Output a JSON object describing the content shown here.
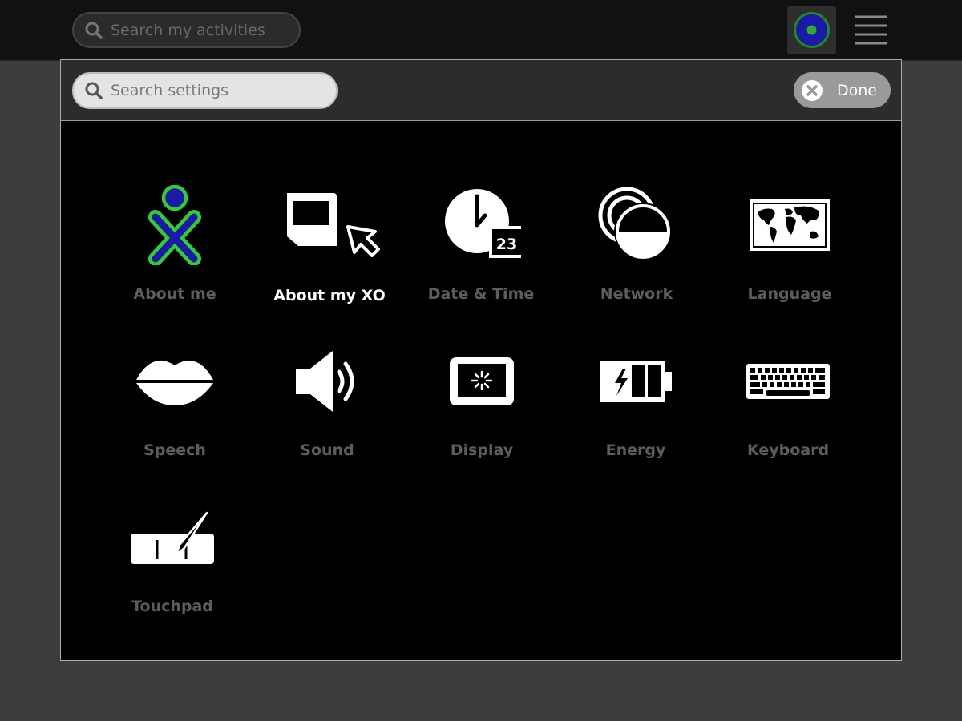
{
  "topbar": {
    "activity_search": {
      "placeholder": "Search my activities",
      "value": ""
    }
  },
  "toolbar": {
    "settings_search": {
      "placeholder": "Search settings",
      "value": ""
    },
    "done_label": "Done"
  },
  "settings_items": [
    {
      "label": "About me",
      "icon": "xo-person-icon",
      "selected": false
    },
    {
      "label": "About my XO",
      "icon": "computer-arrow-icon",
      "selected": true
    },
    {
      "label": "Date & Time",
      "icon": "clock-calendar-icon",
      "calendar_day": "23",
      "selected": false
    },
    {
      "label": "Network",
      "icon": "network-icon",
      "selected": false
    },
    {
      "label": "Language",
      "icon": "world-map-icon",
      "selected": false
    },
    {
      "label": "Speech",
      "icon": "lips-icon",
      "selected": false
    },
    {
      "label": "Sound",
      "icon": "speaker-icon",
      "selected": false
    },
    {
      "label": "Display",
      "icon": "display-icon",
      "selected": false
    },
    {
      "label": "Energy",
      "icon": "battery-icon",
      "selected": false
    },
    {
      "label": "Keyboard",
      "icon": "keyboard-icon",
      "selected": false
    },
    {
      "label": "Touchpad",
      "icon": "touchpad-icon",
      "selected": false
    }
  ],
  "colors": {
    "xo_stroke": "#33cc33",
    "xo_fill": "#1a1aa6",
    "label_inactive": "#5d5d5d",
    "label_selected": "#ffffff"
  }
}
